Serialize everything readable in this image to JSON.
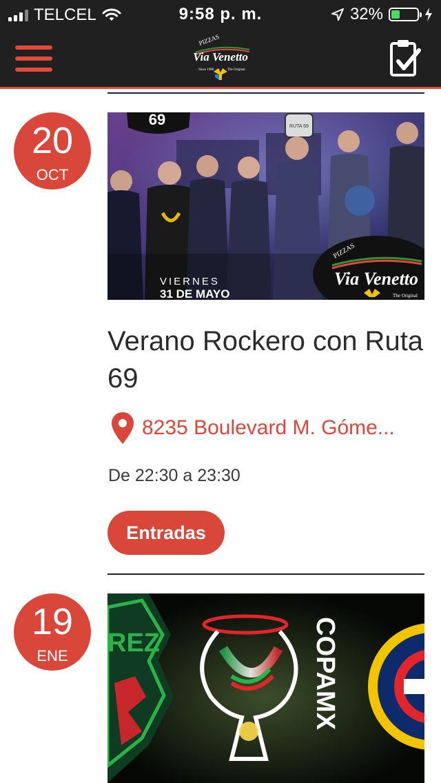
{
  "status_bar": {
    "carrier": "TELCEL",
    "time": "9:58 p. m.",
    "battery": "32%"
  },
  "header": {
    "logo_text_top": "PIZZAS",
    "logo_text": "Via Venetto",
    "logo_since": "Since 1980",
    "logo_original": "The Original"
  },
  "events": [
    {
      "day": "20",
      "month": "OCT",
      "poster": {
        "band_mark": "69",
        "sign": "RUTA 69",
        "line1": "VIERNES",
        "line2": "31 DE MAYO",
        "brand_top": "PIZZAS",
        "brand": "Via Venetto",
        "brand_sub": "The Original"
      },
      "title": "Verano Rockero con Ruta 69",
      "location": "8235 Boulevard M. Góme...",
      "time": "De 22:30 a 23:30",
      "ticket_label": "Entradas"
    },
    {
      "day": "19",
      "month": "ENE",
      "poster": {
        "left_text": "REZ",
        "copa": "COPAMX"
      }
    }
  ],
  "colors": {
    "accent": "#d9473b",
    "header_bg": "#202020"
  }
}
